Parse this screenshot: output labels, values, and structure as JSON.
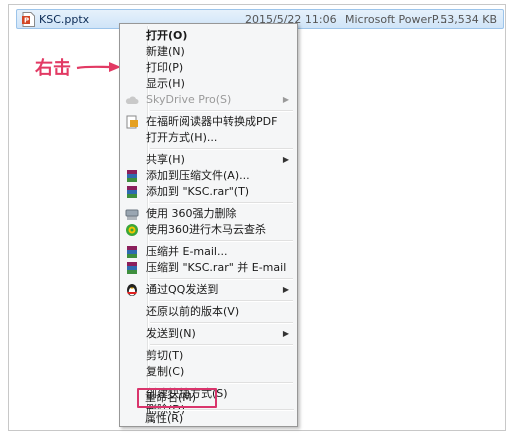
{
  "file": {
    "name": "KSC.pptx",
    "date": "2015/5/22 11:06",
    "type": "Microsoft PowerP...",
    "size": "53,534 KB",
    "icon": "powerpoint-file-icon"
  },
  "annotation": {
    "text": "右击",
    "color": "#e23a64"
  },
  "menu": {
    "items": [
      {
        "label": "打开(O)"
      },
      {
        "label": "新建(N)"
      },
      {
        "label": "打印(P)"
      },
      {
        "label": "显示(H)"
      },
      {
        "label": "SkyDrive Pro(S)",
        "icon": "cloud-icon"
      },
      {
        "label": "在福昕阅读器中转换成PDF",
        "icon": "foxit-pdf-icon"
      },
      {
        "label": "打开方式(H)..."
      },
      {
        "label": "共享(H)"
      },
      {
        "label": "添加到压缩文件(A)...",
        "icon": "winrar-icon"
      },
      {
        "label": "添加到 \"KSC.rar\"(T)",
        "icon": "winrar-icon"
      },
      {
        "label": "使用 360强力删除",
        "icon": "shredder-icon"
      },
      {
        "label": "使用360进行木马云查杀",
        "icon": "360-security-icon"
      },
      {
        "label": "压缩并 E-mail...",
        "icon": "winrar-icon"
      },
      {
        "label": "压缩到 \"KSC.rar\" 并 E-mail",
        "icon": "winrar-icon"
      },
      {
        "label": "通过QQ发送到",
        "icon": "qq-penguin-icon"
      },
      {
        "label": "还原以前的版本(V)"
      },
      {
        "label": "发送到(N)"
      },
      {
        "label": "剪切(T)"
      },
      {
        "label": "复制(C)"
      },
      {
        "label": "创建快捷方式(S)"
      },
      {
        "label": "删除(D)"
      },
      {
        "label": "重命名(M)"
      },
      {
        "label": "属性(R)"
      }
    ]
  },
  "colors": {
    "highlight": "#d9356c",
    "selection": "#cfe4f8"
  }
}
